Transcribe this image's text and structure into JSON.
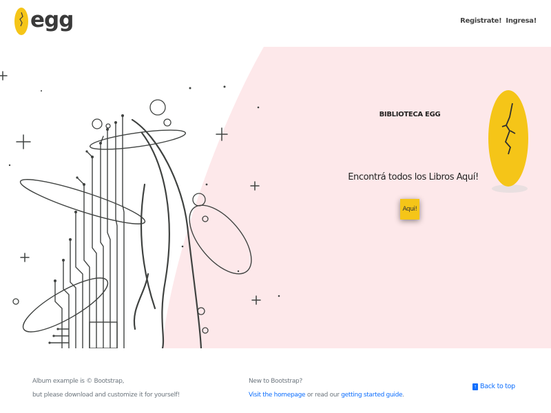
{
  "brand": {
    "logo_text": "egg",
    "logo_icon": "cracked-egg-icon",
    "accent_color": "#f5c518"
  },
  "nav": {
    "register_label": "Registrate!",
    "login_label": "Ingresa!"
  },
  "hero": {
    "title": "BIBLIOTECA EGG",
    "subtitle": "Encontrá todos los Libros Aquí!",
    "button_label": "Aqui!",
    "background_color": "#fde8ea",
    "illustration": "astronaut-circuit-sketch"
  },
  "footer": {
    "left_line1": "Album example is © Bootstrap,",
    "left_line2": "but please download and customize it for yourself!",
    "mid_line1": "New to Bootstrap?",
    "mid_link1": "Visit the homepage",
    "mid_text": " or read our ",
    "mid_link2": "getting started guide",
    "mid_end": ".",
    "back_to_top": "Back to top",
    "back_to_top_icon": "arrow-up-square-icon"
  }
}
